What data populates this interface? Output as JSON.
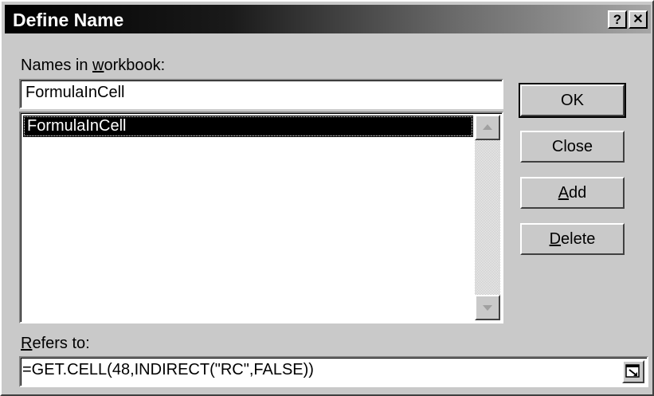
{
  "window": {
    "title": "Define Name",
    "help_label": "?",
    "close_label": "✕"
  },
  "names": {
    "label_pre": "Names in ",
    "label_accel": "w",
    "label_post": "orkbook:",
    "input_value": "FormulaInCell",
    "list": [
      "FormulaInCell"
    ]
  },
  "buttons": {
    "ok": "OK",
    "close": "Close",
    "add_accel": "A",
    "add_rest": "dd",
    "delete_accel": "D",
    "delete_rest": "elete"
  },
  "refers": {
    "label_accel": "R",
    "label_rest": "efers to:",
    "value": "=GET.CELL(48,INDIRECT(\"RC\",FALSE))"
  },
  "icons": {
    "scroll_up": "scroll-up-arrow-icon",
    "scroll_down": "scroll-down-arrow-icon",
    "collapse": "collapse-dialog-icon"
  }
}
